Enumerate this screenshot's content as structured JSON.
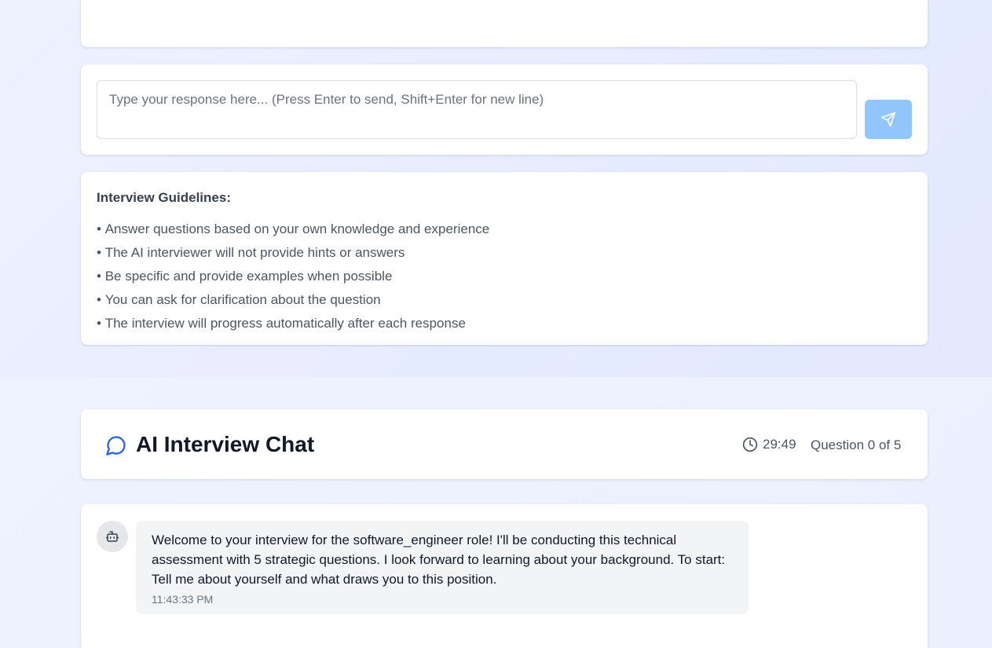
{
  "composer": {
    "placeholder": "Type your response here... (Press Enter to send, Shift+Enter for new line)",
    "value": "",
    "send_button_icon": "send-icon",
    "send_button_color": "#93c5fd"
  },
  "guidelines": {
    "title": "Interview Guidelines:",
    "items": [
      "Answer questions based on your own knowledge and experience",
      "The AI interviewer will not provide hints or answers",
      "Be specific and provide examples when possible",
      "You can ask for clarification about the question",
      "The interview will progress automatically after each response"
    ]
  },
  "chat_header": {
    "icon": "chat-bubble-icon",
    "title": "AI Interview Chat",
    "timer_icon": "clock-icon",
    "timer": "29:49",
    "question_progress": "Question 0 of 5",
    "accent_color": "#2563eb"
  },
  "messages": [
    {
      "sender_icon": "bot-icon",
      "text": "Welcome to your interview for the software_engineer role! I'll be conducting this technical assessment with 5 strategic questions. I look forward to learning about your background. To start: Tell me about yourself and what draws you to this position.",
      "time": "11:43:33 PM"
    }
  ]
}
